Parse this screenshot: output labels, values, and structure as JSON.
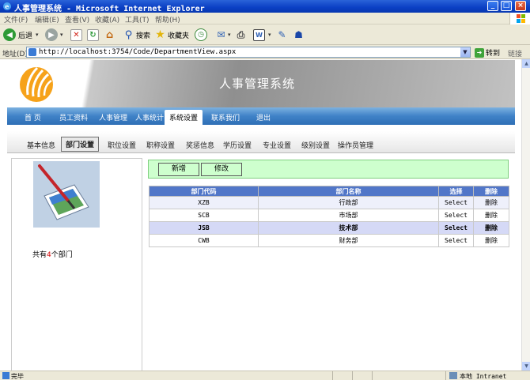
{
  "window": {
    "title": "人事管理系统 - Microsoft Internet Explorer",
    "minimize": "_",
    "maximize": "□",
    "close": "×"
  },
  "menubar": [
    "文件(F)",
    "编辑(E)",
    "查看(V)",
    "收藏(A)",
    "工具(T)",
    "帮助(H)"
  ],
  "toolbar": {
    "back": "后退",
    "search": "搜索",
    "favorites": "收藏夹"
  },
  "addressbar": {
    "label": "地址(D)",
    "url": "http://localhost:3754/Code/DepartmentView.aspx",
    "go": "转到",
    "links": "链接"
  },
  "site": {
    "title": "人事管理系统",
    "main_nav": [
      "首 页",
      "员工资料",
      "人事管理",
      "人事统计",
      "系统设置",
      "联系我们",
      "退出"
    ],
    "main_nav_active": "系统设置",
    "sub_nav": [
      "基本信息",
      "部门设置",
      "职位设置",
      "职称设置",
      "奖惩信息",
      "学历设置",
      "专业设置",
      "级别设置",
      "操作员管理"
    ],
    "sub_nav_active": "部门设置"
  },
  "left": {
    "count_prefix": "共有",
    "count": "4",
    "count_suffix": "个部门"
  },
  "actions": {
    "add": "新增",
    "edit": "修改"
  },
  "grid": {
    "headers": [
      "部门代码",
      "部门名称",
      "选择",
      "删除"
    ],
    "rows": [
      {
        "code": "XZB",
        "name": "行政部",
        "select": "Select",
        "delete": "删除"
      },
      {
        "code": "SCB",
        "name": "市场部",
        "select": "Select",
        "delete": "删除"
      },
      {
        "code": "JSB",
        "name": "技术部",
        "select": "Select",
        "delete": "删除"
      },
      {
        "code": "CWB",
        "name": "财务部",
        "select": "Select",
        "delete": "删除"
      }
    ],
    "selected_row": 2
  },
  "statusbar": {
    "status": "完毕",
    "zone": "本地 Intranet"
  },
  "colors": {
    "titlebar": "#0a3fc4",
    "nav": "#3f82c7",
    "grid_header": "#5176c8",
    "action_box": "#ceffce",
    "count_number": "#d60000"
  }
}
